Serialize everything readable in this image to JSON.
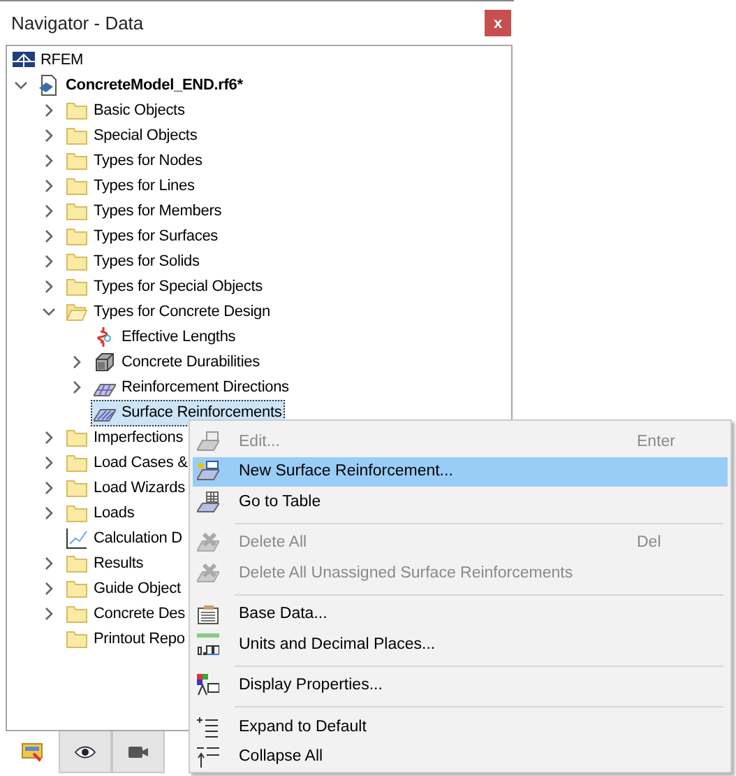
{
  "window": {
    "title": "Navigator - Data",
    "close": "x"
  },
  "tree": [
    {
      "label": "RFEM",
      "kind": "root",
      "selected": false,
      "children": [
        {
          "label": "ConcreteModel_END.rf6*",
          "kind": "model",
          "expanded": true,
          "selected": false,
          "children": [
            {
              "label": "Basic Objects",
              "kind": "folder",
              "expanded": false,
              "selected": false
            },
            {
              "label": "Special Objects",
              "kind": "folder",
              "expanded": false,
              "selected": false
            },
            {
              "label": "Types for Nodes",
              "kind": "folder",
              "expanded": false,
              "selected": false
            },
            {
              "label": "Types for Lines",
              "kind": "folder",
              "expanded": false,
              "selected": false
            },
            {
              "label": "Types for Members",
              "kind": "folder",
              "expanded": false,
              "selected": false
            },
            {
              "label": "Types for Surfaces",
              "kind": "folder",
              "expanded": false,
              "selected": false
            },
            {
              "label": "Types for Solids",
              "kind": "folder",
              "expanded": false,
              "selected": false
            },
            {
              "label": "Types for Special Objects",
              "kind": "folder",
              "expanded": false,
              "selected": false
            },
            {
              "label": "Types for Concrete Design",
              "kind": "folder",
              "expanded": true,
              "selected": false,
              "children": [
                {
                  "label": "Effective Lengths",
                  "kind": "lengths",
                  "selected": false
                },
                {
                  "label": "Concrete Durabilities",
                  "kind": "durability",
                  "expanded": false,
                  "selected": false
                },
                {
                  "label": "Reinforcement Directions",
                  "kind": "directions",
                  "expanded": false,
                  "selected": false
                },
                {
                  "label": "Surface Reinforcements",
                  "kind": "reinforcement",
                  "selected": true
                }
              ]
            },
            {
              "label": "Imperfections",
              "kind": "folder",
              "expanded": false,
              "selected": false
            },
            {
              "label": "Load Cases &",
              "kind": "folder",
              "expanded": false,
              "selected": false
            },
            {
              "label": "Load Wizards",
              "kind": "folder",
              "expanded": false,
              "selected": false
            },
            {
              "label": "Loads",
              "kind": "folder",
              "expanded": false,
              "selected": false
            },
            {
              "label": "Calculation D",
              "kind": "chart",
              "selected": false
            },
            {
              "label": "Results",
              "kind": "folder",
              "expanded": false,
              "selected": false
            },
            {
              "label": "Guide Object",
              "kind": "folder",
              "expanded": false,
              "selected": false
            },
            {
              "label": "Concrete Des",
              "kind": "folder",
              "expanded": false,
              "selected": false
            },
            {
              "label": "Printout Repo",
              "kind": "folder",
              "selected": false
            }
          ]
        }
      ]
    }
  ],
  "context_menu": [
    {
      "kind": "edit",
      "label": "Edit...",
      "shortcut": "Enter",
      "disabled": true,
      "selected": false
    },
    {
      "kind": "new",
      "label": "New Surface Reinforcement...",
      "disabled": false,
      "selected": true
    },
    {
      "kind": "table",
      "label": "Go to Table",
      "disabled": false,
      "selected": false
    },
    {
      "kind": "separator"
    },
    {
      "kind": "delete",
      "label": "Delete All",
      "shortcut": "Del",
      "disabled": true,
      "selected": false
    },
    {
      "kind": "delete",
      "label": "Delete All Unassigned Surface Reinforcements",
      "disabled": true,
      "selected": false
    },
    {
      "kind": "separator"
    },
    {
      "kind": "base",
      "label": "Base Data...",
      "disabled": false,
      "selected": false
    },
    {
      "kind": "units",
      "label": "Units and Decimal Places...",
      "disabled": false,
      "selected": false
    },
    {
      "kind": "separator"
    },
    {
      "kind": "display",
      "label": "Display Properties...",
      "disabled": false,
      "selected": false
    },
    {
      "kind": "separator"
    },
    {
      "kind": "expand",
      "label": "Expand to Default",
      "disabled": false,
      "selected": false
    },
    {
      "kind": "collapse",
      "label": "Collapse All",
      "disabled": false,
      "selected": false
    }
  ],
  "bottom_tabs": [
    {
      "kind": "data",
      "selected": true
    },
    {
      "kind": "view",
      "selected": false
    },
    {
      "kind": "camera",
      "selected": false
    }
  ]
}
